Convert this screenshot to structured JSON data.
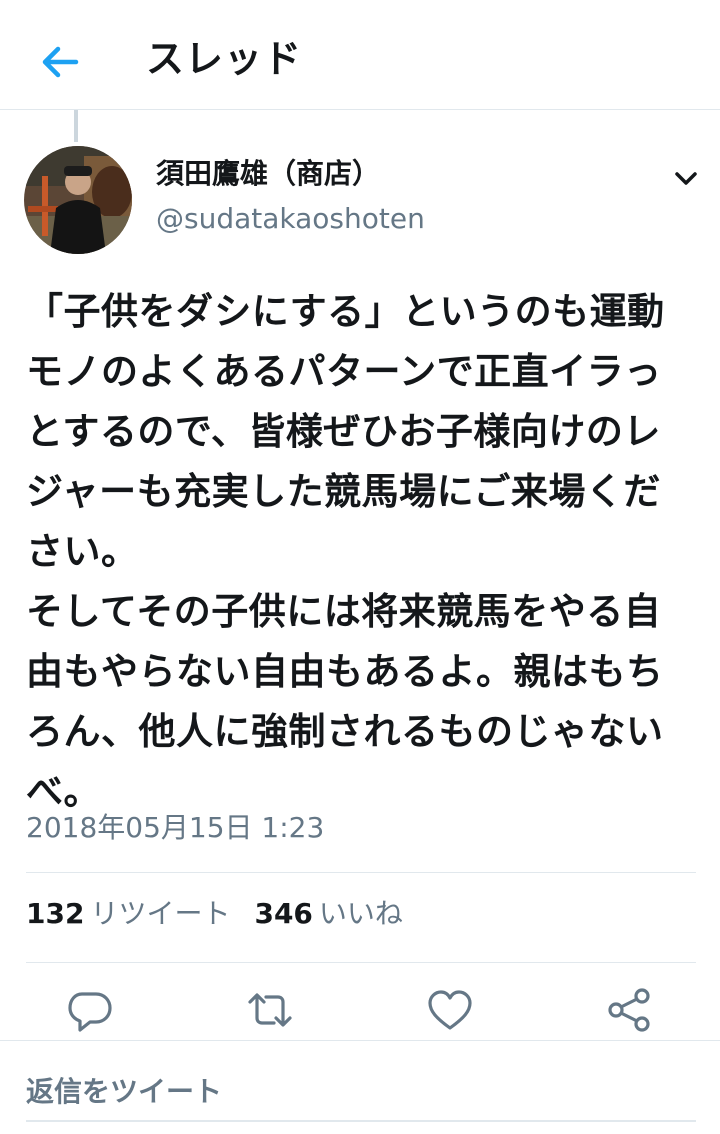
{
  "header": {
    "title": "スレッド",
    "back_icon": "arrow-left-icon",
    "accent_color": "#1da1f2"
  },
  "tweet": {
    "author_name": "須田鷹雄（商店）",
    "author_handle": "@sudatakaoshoten",
    "text": "「子供をダシにする」というのも運動モノのよくあるパターンで正直イラっとするので、皆様ぜひお子様向けのレジャーも充実した競馬場にご来場ください。\nそしてその子供には将来競馬をやる自由もやらない自由もあるよ。親はもちろん、他人に強制されるものじゃないべ。",
    "timestamp": "2018年05月15日 1:23",
    "retweet_count": "132",
    "retweet_label": "リツイート",
    "like_count": "346",
    "like_label": "いいね"
  },
  "actions": [
    {
      "name": "reply",
      "icon": "comment-icon"
    },
    {
      "name": "retweet",
      "icon": "retweet-icon"
    },
    {
      "name": "like",
      "icon": "heart-icon"
    },
    {
      "name": "share",
      "icon": "share-icon"
    }
  ],
  "reply_box": {
    "placeholder": "返信をツイート"
  },
  "colors": {
    "text": "#14171a",
    "secondary": "#657786",
    "divider": "#e1e8ed",
    "accent": "#1da1f2"
  }
}
